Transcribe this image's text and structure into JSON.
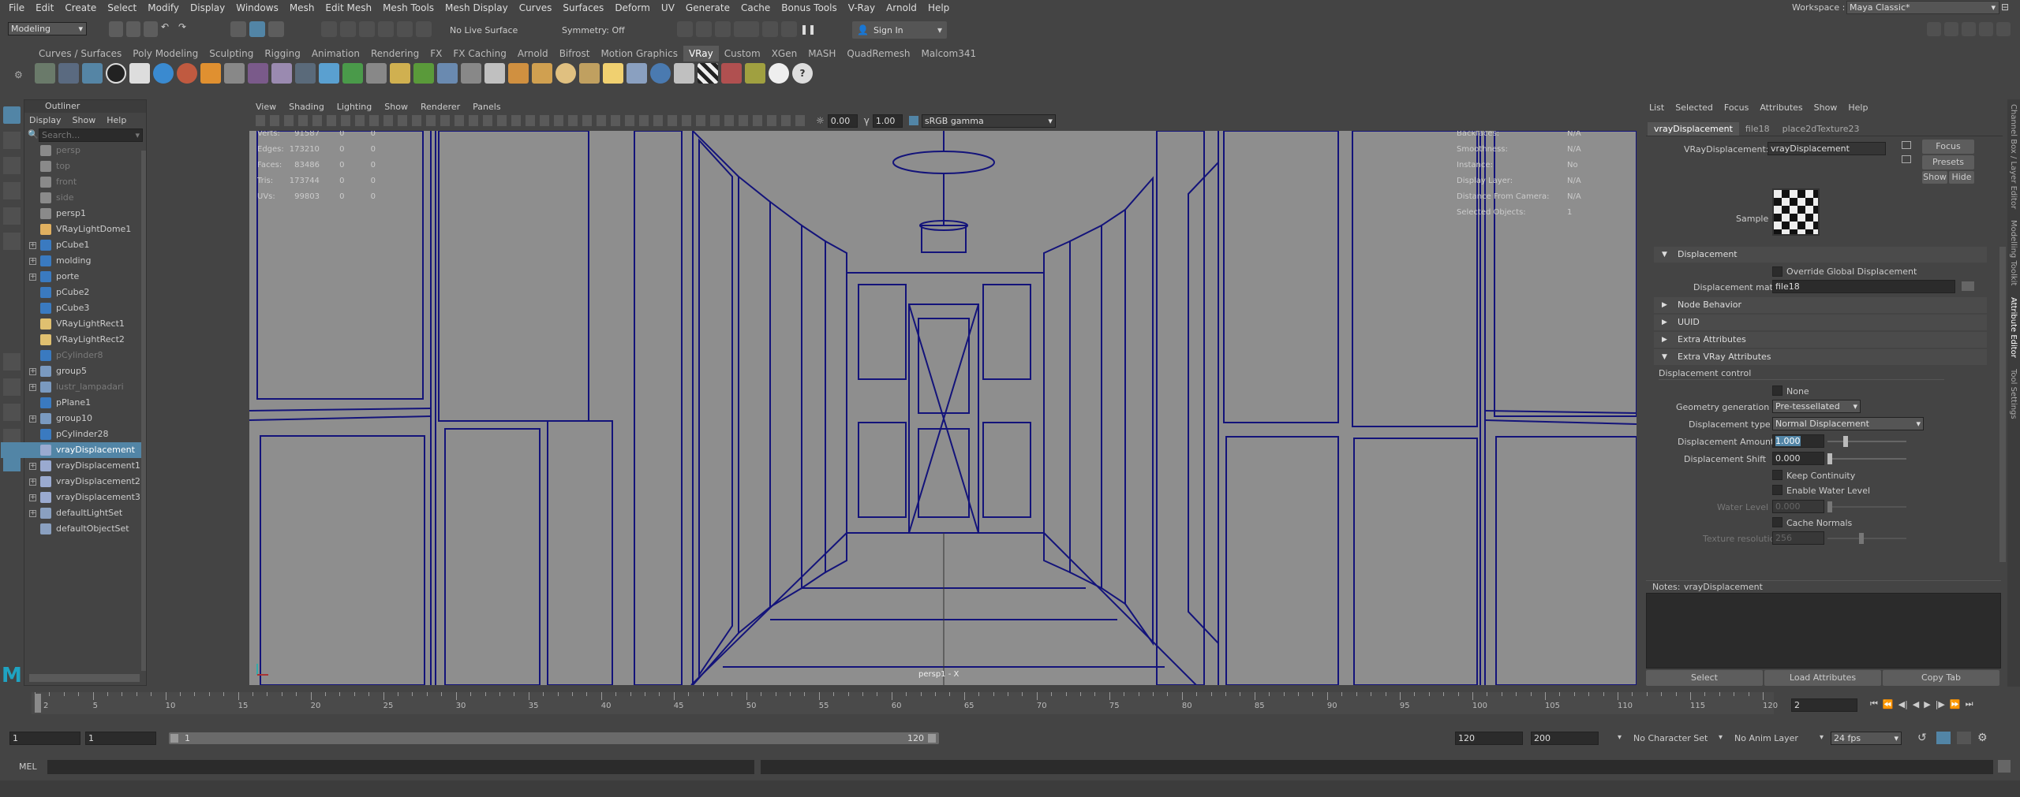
{
  "menubar": {
    "items": [
      "File",
      "Edit",
      "Create",
      "Select",
      "Modify",
      "Display",
      "Windows",
      "Mesh",
      "Edit Mesh",
      "Mesh Tools",
      "Mesh Display",
      "Curves",
      "Surfaces",
      "Deform",
      "UV",
      "Generate",
      "Cache",
      "Bonus Tools",
      "V-Ray",
      "Arnold",
      "Help"
    ],
    "workspace_label": "Workspace :",
    "workspace_value": "Maya Classic*"
  },
  "statusline": {
    "mode": "Modeling",
    "live_surface": "No Live Surface",
    "symmetry": "Symmetry: Off",
    "sign_in": "Sign In"
  },
  "shelf": {
    "tabs": [
      "Curves / Surfaces",
      "Poly Modeling",
      "Sculpting",
      "Rigging",
      "Animation",
      "Rendering",
      "FX",
      "FX Caching",
      "Arnold",
      "Bifrost",
      "Motion Graphics",
      "VRay",
      "Custom",
      "XGen",
      "MASH",
      "QuadRemesh",
      "Malcom341"
    ],
    "active_tab": "VRay"
  },
  "outliner": {
    "title": "Outliner",
    "menu": [
      "Display",
      "Show",
      "Help"
    ],
    "search_placeholder": "Search...",
    "items": [
      {
        "label": "persp",
        "exp": false,
        "dim": true,
        "icon": "camera-icon"
      },
      {
        "label": "top",
        "exp": false,
        "dim": true,
        "icon": "camera-icon"
      },
      {
        "label": "front",
        "exp": false,
        "dim": true,
        "icon": "camera-icon"
      },
      {
        "label": "side",
        "exp": false,
        "dim": true,
        "icon": "camera-icon"
      },
      {
        "label": "persp1",
        "exp": false,
        "dim": false,
        "icon": "camera-icon"
      },
      {
        "label": "VRayLightDome1",
        "exp": false,
        "dim": false,
        "icon": "dome-light-icon"
      },
      {
        "label": "pCube1",
        "exp": true,
        "dim": false,
        "icon": "mesh-icon"
      },
      {
        "label": "molding",
        "exp": true,
        "dim": false,
        "icon": "mesh-icon"
      },
      {
        "label": "porte",
        "exp": true,
        "dim": false,
        "icon": "mesh-icon"
      },
      {
        "label": "pCube2",
        "exp": false,
        "dim": false,
        "icon": "mesh-icon"
      },
      {
        "label": "pCube3",
        "exp": false,
        "dim": false,
        "icon": "mesh-icon"
      },
      {
        "label": "VRayLightRect1",
        "exp": false,
        "dim": false,
        "icon": "rect-light-icon"
      },
      {
        "label": "VRayLightRect2",
        "exp": false,
        "dim": false,
        "icon": "rect-light-icon"
      },
      {
        "label": "pCylinder8",
        "exp": false,
        "dim": true,
        "icon": "mesh-icon"
      },
      {
        "label": "group5",
        "exp": true,
        "dim": false,
        "icon": "group-icon"
      },
      {
        "label": "lustr_lampadari",
        "exp": true,
        "dim": true,
        "icon": "group-icon"
      },
      {
        "label": "pPlane1",
        "exp": false,
        "dim": false,
        "icon": "mesh-icon"
      },
      {
        "label": "group10",
        "exp": true,
        "dim": false,
        "icon": "group-icon"
      },
      {
        "label": "pCylinder28",
        "exp": false,
        "dim": false,
        "icon": "mesh-icon"
      },
      {
        "label": "vrayDisplacement",
        "exp": false,
        "dim": false,
        "sel": true,
        "icon": "displacement-icon"
      },
      {
        "label": "vrayDisplacement1",
        "exp": true,
        "dim": false,
        "icon": "displacement-icon"
      },
      {
        "label": "vrayDisplacement2",
        "exp": true,
        "dim": false,
        "icon": "displacement-icon"
      },
      {
        "label": "vrayDisplacement3",
        "exp": true,
        "dim": false,
        "icon": "displacement-icon"
      },
      {
        "label": "defaultLightSet",
        "exp": true,
        "dim": false,
        "icon": "set-icon"
      },
      {
        "label": "defaultObjectSet",
        "exp": false,
        "dim": false,
        "icon": "set-icon"
      }
    ]
  },
  "viewport": {
    "menu": [
      "View",
      "Shading",
      "Lighting",
      "Show",
      "Renderer",
      "Panels"
    ],
    "exposure": "0.00",
    "gamma": "1.00",
    "colorspace": "sRGB gamma",
    "camera_label": "persp1 - X",
    "hud_left": [
      {
        "k": "Verts:",
        "v": "91587",
        "a": "0",
        "b": "0"
      },
      {
        "k": "Edges:",
        "v": "173210",
        "a": "0",
        "b": "0"
      },
      {
        "k": "Faces:",
        "v": "83486",
        "a": "0",
        "b": "0"
      },
      {
        "k": "Tris:",
        "v": "173744",
        "a": "0",
        "b": "0"
      },
      {
        "k": "UVs:",
        "v": "99803",
        "a": "0",
        "b": "0"
      }
    ],
    "hud_right": [
      {
        "k": "Backfaces:",
        "v": "N/A"
      },
      {
        "k": "Smoothness:",
        "v": "N/A"
      },
      {
        "k": "Instance:",
        "v": "No"
      },
      {
        "k": "Display Layer:",
        "v": "N/A"
      },
      {
        "k": "Distance From Camera:",
        "v": "N/A"
      },
      {
        "k": "Selected Objects:",
        "v": "1"
      }
    ]
  },
  "attr": {
    "menu": [
      "List",
      "Selected",
      "Focus",
      "Attributes",
      "Show",
      "Help"
    ],
    "tabs": [
      "vrayDisplacement",
      "file18",
      "place2dTexture23"
    ],
    "node_label": "VRayDisplacement:",
    "node_value": "vrayDisplacement",
    "focus": "Focus",
    "presets": "Presets",
    "show": "Show",
    "hide": "Hide",
    "sample": "Sample",
    "sections": {
      "displacement": "Displacement",
      "node_behavior": "Node Behavior",
      "uuid": "UUID",
      "extra": "Extra Attributes",
      "extra_vray": "Extra VRay Attributes"
    },
    "override": "Override Global Displacement",
    "disp_mat_label": "Displacement mat.",
    "disp_mat_value": "file18",
    "disp_control": "Displacement control",
    "none": "None",
    "geom_gen_label": "Geometry generation",
    "geom_gen_value": "Pre-tessellated",
    "disp_type_label": "Displacement type",
    "disp_type_value": "Normal Displacement",
    "amount_label": "Displacement Amount",
    "amount_value": "1.000",
    "shift_label": "Displacement Shift",
    "shift_value": "0.000",
    "keep": "Keep Continuity",
    "water": "Enable Water Level",
    "water_level_label": "Water Level",
    "water_level_value": "0.000",
    "cache": "Cache Normals",
    "tex_res_label": "Texture resolution",
    "tex_res_value": "256",
    "notes_label": "Notes:",
    "notes_value": "vrayDisplacement",
    "select": "Select",
    "load": "Load Attributes",
    "copy": "Copy Tab"
  },
  "side_tabs": [
    "Channel Box / Layer Editor",
    "Modelling Toolkit",
    "Attribute Editor",
    "Tool Settings"
  ],
  "timeline": {
    "ticks": [
      "2",
      "5",
      "10",
      "15",
      "20",
      "25",
      "30",
      "35",
      "40",
      "45",
      "50",
      "55",
      "60",
      "65",
      "70",
      "75",
      "80",
      "85",
      "90",
      "95",
      "100",
      "105",
      "110",
      "115",
      "120"
    ],
    "current": "2"
  },
  "range": {
    "start": "1",
    "start2": "1",
    "slider_start": "1",
    "slider_end": "120",
    "end": "120",
    "end2": "200",
    "char_set": "No Character Set",
    "anim_layer": "No Anim Layer",
    "fps": "24 fps"
  },
  "cmd": {
    "label": "MEL"
  }
}
